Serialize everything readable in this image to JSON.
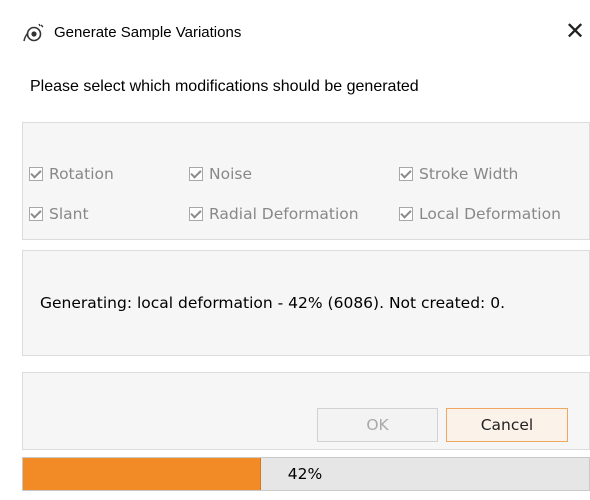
{
  "window": {
    "title": "Generate Sample Variations",
    "close_glyph": "✕",
    "icon": "app-settings-icon"
  },
  "prompt": "Please select which modifications should be generated",
  "options": [
    {
      "label": "Rotation",
      "checked": true,
      "enabled": false
    },
    {
      "label": "Noise",
      "checked": true,
      "enabled": false
    },
    {
      "label": "Stroke Width",
      "checked": true,
      "enabled": false
    },
    {
      "label": "Slant",
      "checked": true,
      "enabled": false
    },
    {
      "label": "Radial Deformation",
      "checked": true,
      "enabled": false
    },
    {
      "label": "Local Deformation",
      "checked": true,
      "enabled": false
    }
  ],
  "status": "Generating: local deformation - 42% (6086). Not created: 0.",
  "buttons": {
    "ok": "OK",
    "cancel": "Cancel"
  },
  "progress": {
    "value": 0.42,
    "label": "42%"
  },
  "colors": {
    "accent": "#f28a26",
    "panel": "#f6f6f6",
    "disabled_text": "#888888"
  }
}
